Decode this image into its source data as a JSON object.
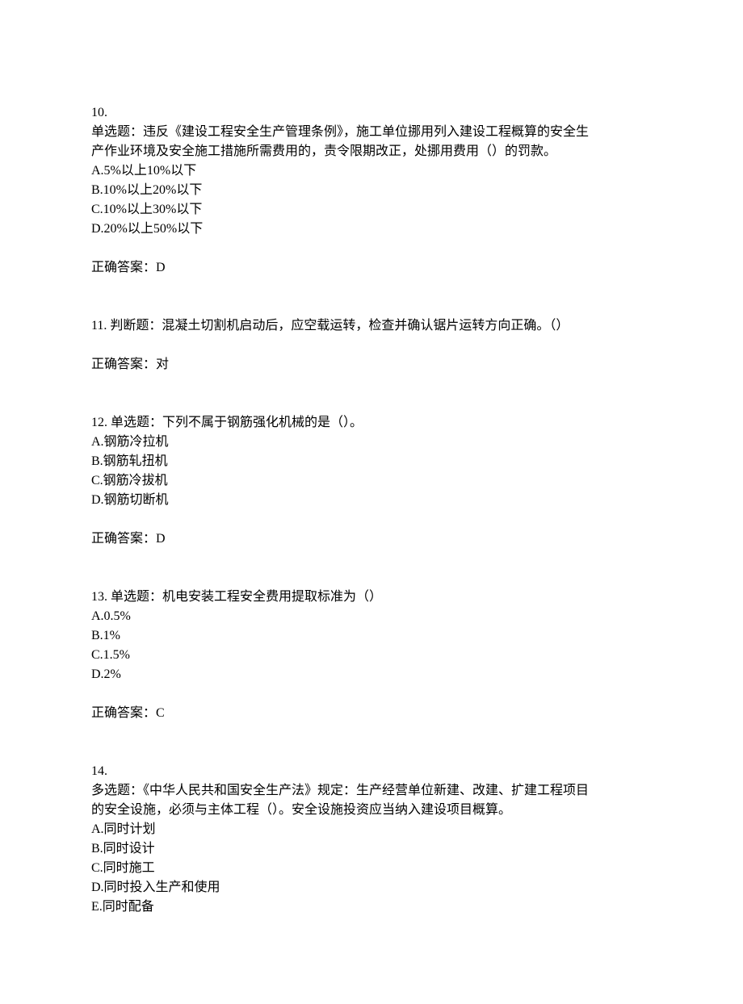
{
  "questions": [
    {
      "number": "10.",
      "prefix_spaced": false,
      "prompt_lines": [
        "单选题：违反《建设工程安全生产管理条例》，施工单位挪用列入建设工程概算的安全生",
        "产作业环境及安全施工措施所需费用的，责令限期改正，处挪用费用（）的罚款。"
      ],
      "options": [
        "A.5%以上10%以下",
        "B.10%以上20%以下",
        "C.10%以上30%以下",
        "D.20%以上50%以下"
      ],
      "answer": "正确答案：D"
    },
    {
      "number": "11. ",
      "prefix_spaced": true,
      "prompt_lines": [
        "判断题：混凝土切割机启动后，应空载运转，检查并确认锯片运转方向正确。（）"
      ],
      "options": [],
      "answer": "正确答案：对"
    },
    {
      "number": "12. ",
      "prefix_spaced": true,
      "prompt_lines": [
        "单选题：下列不属于钢筋强化机械的是（）。"
      ],
      "options": [
        "A.钢筋冷拉机",
        "B.钢筋轧扭机",
        "C.钢筋冷拔机",
        "D.钢筋切断机"
      ],
      "answer": "正确答案：D"
    },
    {
      "number": "13. ",
      "prefix_spaced": true,
      "prompt_lines": [
        "单选题：机电安装工程安全费用提取标准为（）"
      ],
      "options": [
        "A.0.5%",
        "B.1%",
        "C.1.5%",
        "D.2%"
      ],
      "answer": "正确答案：C"
    },
    {
      "number": "14.",
      "prefix_spaced": false,
      "prompt_lines": [
        "多选题：《中华人民共和国安全生产法》规定：生产经营单位新建、改建、扩建工程项目",
        "的安全设施，必须与主体工程（）。安全设施投资应当纳入建设项目概算。"
      ],
      "options": [
        "A.同时计划",
        "B.同时设计",
        "C.同时施工",
        "D.同时投入生产和使用",
        "E.同时配备"
      ],
      "answer": null
    }
  ]
}
